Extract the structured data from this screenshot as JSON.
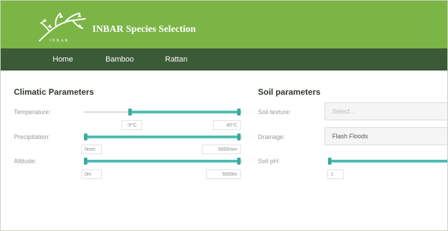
{
  "app": {
    "title": "INBAR Species Selection",
    "logo_text": "INBAR"
  },
  "nav": {
    "items": [
      "Home",
      "Bamboo",
      "Rattan"
    ]
  },
  "climatic": {
    "title": "Climatic Parameters",
    "temperature": {
      "label": "Temperature:",
      "min_value": "-9°C",
      "max_value": "40°C"
    },
    "precipitation": {
      "label": "Precipitation:",
      "min_value": "0mm",
      "max_value": "5000mm"
    },
    "altitude": {
      "label": "Altitude:",
      "min_value": "0m",
      "max_value": "5000m"
    }
  },
  "soil": {
    "title": "Soil parameters",
    "texture": {
      "label": "Soil texture:",
      "placeholder": "Select..."
    },
    "drainage": {
      "label": "Drainage:",
      "value": "Flash Floods"
    },
    "ph": {
      "label": "Soil pH:",
      "min_value": "1"
    }
  },
  "colors": {
    "header": "#7ab546",
    "nav": "#3a5a38",
    "slider_accent": "#4dbdb3"
  }
}
